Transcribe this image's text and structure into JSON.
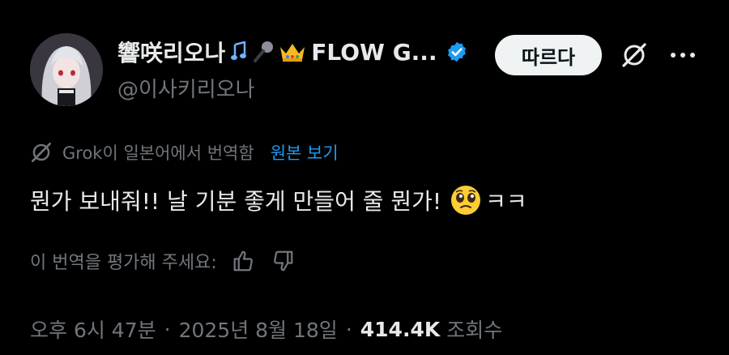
{
  "author": {
    "display_name": "響咲리오나",
    "display_name_suffix": "FLOW G...",
    "handle": "@이사키리오나",
    "emoji": [
      "notes-emoji",
      "microphone-emoji",
      "crown-emoji"
    ],
    "verified_color": "#1d9bf0"
  },
  "actions": {
    "follow_label": "따르다"
  },
  "translation": {
    "note": "Grok이 일본어에서 번역함",
    "view_original": "원본 보기"
  },
  "tweet": {
    "text": "뭔가 보내줘!! 날 기분 좋게 만들어 줄 뭔가!",
    "text_suffix": "ㅋㅋ",
    "emoji": "pleading-face-emoji"
  },
  "rating": {
    "prompt": "이 번역을 평가해 주세요:"
  },
  "meta": {
    "time": "오후 6시 47분",
    "date": "2025년 8월 18일",
    "views": "414.4K",
    "views_label": "조회수"
  },
  "colors": {
    "background": "#000000",
    "text": "#e7e9ea",
    "muted": "#71767b",
    "link": "#1d9bf0",
    "follow_bg": "#eff3f4"
  }
}
